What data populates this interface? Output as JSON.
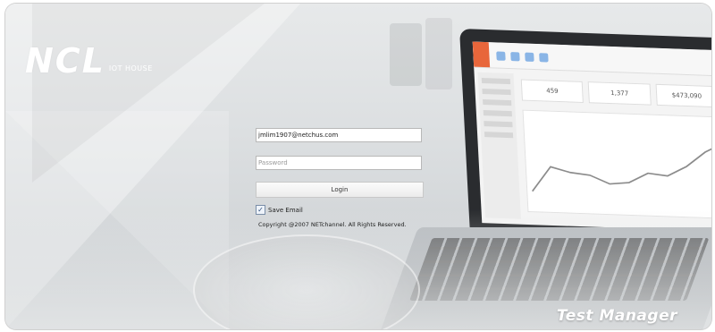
{
  "brand": {
    "logo_text": "NCL",
    "subtitle": "IOT HOUSE",
    "logo_color": "#ffffff"
  },
  "login": {
    "email_value": "jmlim1907@netchus.com",
    "password_placeholder": "Password",
    "login_label": "Login",
    "save_email_label": "Save Email",
    "save_email_checked": true,
    "checkmark": "✓"
  },
  "copyright": "Copyright @2007 NETchannel. All Rights Reserved.",
  "product_title": "Test Manager",
  "laptop_screen": {
    "card_values": [
      "459",
      "1,377",
      "$473,090"
    ]
  },
  "colors": {
    "ribbon_accent": "#e8663b",
    "field_border": "#b8b8b8"
  }
}
